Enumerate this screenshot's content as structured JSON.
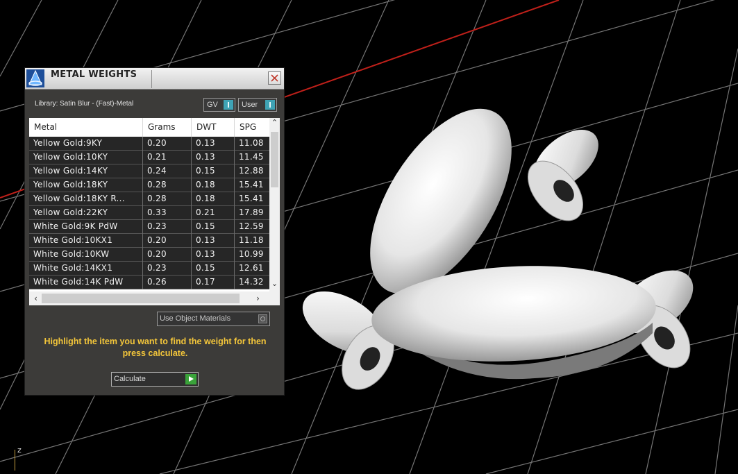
{
  "window": {
    "title": "METAL WEIGHTS"
  },
  "library_label": "Library: Satin Blur - (Fast)-Metal",
  "toggles": {
    "gv_label": "GV",
    "user_label": "User"
  },
  "table": {
    "columns": [
      "Metal",
      "Grams",
      "DWT",
      "SPG"
    ],
    "rows": [
      [
        "Yellow Gold:9KY",
        "0.20",
        "0.13",
        "11.08"
      ],
      [
        "Yellow Gold:10KY",
        "0.21",
        "0.13",
        "11.45"
      ],
      [
        "Yellow Gold:14KY",
        "0.24",
        "0.15",
        "12.88"
      ],
      [
        "Yellow Gold:18KY",
        "0.28",
        "0.18",
        "15.41"
      ],
      [
        "Yellow Gold:18KY R...",
        "0.28",
        "0.18",
        "15.41"
      ],
      [
        "Yellow Gold:22KY",
        "0.33",
        "0.21",
        "17.89"
      ],
      [
        "White Gold:9K PdW",
        "0.23",
        "0.15",
        "12.59"
      ],
      [
        "White Gold:10KX1",
        "0.20",
        "0.13",
        "11.18"
      ],
      [
        "White Gold:10KW",
        "0.20",
        "0.13",
        "10.99"
      ],
      [
        "White Gold:14KX1",
        "0.23",
        "0.15",
        "12.61"
      ],
      [
        "White Gold:14K PdW",
        "0.26",
        "0.17",
        "14.32"
      ]
    ]
  },
  "use_object_materials_label": "Use Object Materials",
  "hint_text": "Highlight the item you want to find the weight for then press calculate.",
  "calculate_label": "Calculate",
  "viewport": {
    "axis_label": "z"
  }
}
